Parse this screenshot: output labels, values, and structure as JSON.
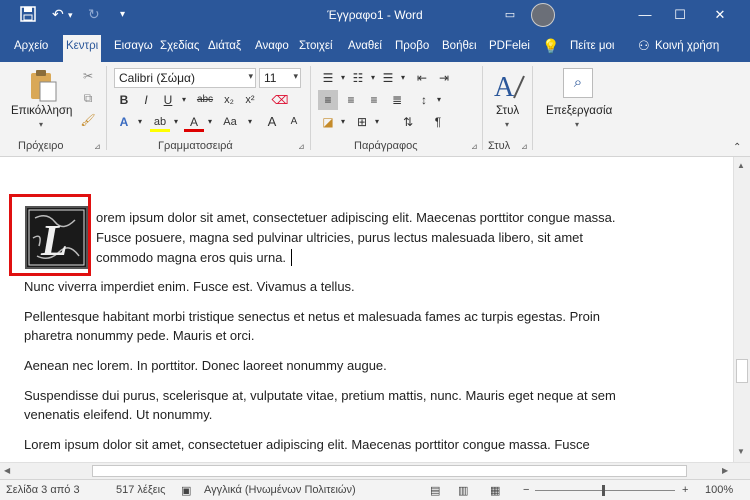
{
  "titlebar": {
    "title": "Έγγραφο1 - Word",
    "save_icon": "save-icon",
    "undo_icon": "undo-icon",
    "redo_icon": "redo-icon",
    "customize_icon": "chevron-down-icon"
  },
  "tabs": [
    {
      "label": "Αρχείο"
    },
    {
      "label": "Κεντρι"
    },
    {
      "label": "Εισαγω"
    },
    {
      "label": "Σχεδίας"
    },
    {
      "label": "Διάταξ"
    },
    {
      "label": "Αναφο"
    },
    {
      "label": "Στοιχεί"
    },
    {
      "label": "Αναθεί"
    },
    {
      "label": "Προβο"
    },
    {
      "label": "Βοήθει"
    },
    {
      "label": "PDFelei"
    },
    {
      "label": "Πείτε μοι"
    },
    {
      "label": "Κοινή χρήση"
    }
  ],
  "ribbon": {
    "paste_label": "Επικόλληση",
    "font_name": "Calibri (Σώμα)",
    "font_size": "11",
    "styles_label": "Στυλ",
    "editing_label": "Επεξεργασία",
    "groups": {
      "clipboard": "Πρόχειρο",
      "font": "Γραμματοσειρά",
      "paragraph": "Παράγραφος",
      "styles": "Στυλ"
    },
    "buttons": {
      "bold": "B",
      "italic": "I",
      "underline": "U",
      "strike": "abc",
      "sub": "x₂",
      "sup": "x²",
      "font_color": "A",
      "highlight": "ab",
      "case": "Aa",
      "grow": "A",
      "shrink": "A"
    }
  },
  "document": {
    "paragraphs": [
      "orem ipsum dolor sit amet, consectetuer adipiscing elit. Maecenas porttitor congue massa.",
      "Fusce posuere, magna sed pulvinar ultricies, purus lectus malesuada libero, sit amet",
      "commodo magna eros quis urna.",
      "Nunc viverra imperdiet enim. Fusce est. Vivamus a tellus.",
      "Pellentesque habitant morbi tristique senectus et netus et malesuada fames ac turpis egestas. Proin",
      "pharetra nonummy pede. Mauris et orci.",
      "Aenean nec lorem. In porttitor. Donec laoreet nonummy augue.",
      "Suspendisse dui purus, scelerisque at, vulputate vitae, pretium mattis, nunc. Mauris eget neque at sem",
      "venenatis eleifend. Ut nonummy.",
      "Lorem ipsum dolor sit amet, consectetuer adipiscing elit. Maecenas porttitor congue massa. Fusce"
    ]
  },
  "status": {
    "page": "Σελίδα 3 από 3",
    "words": "517 λέξεις",
    "language": "Αγγλικά (Ηνωμένων Πολιτειών)",
    "zoom": "100%"
  },
  "colors": {
    "brand": "#2b579a",
    "highlight_border": "#e01010"
  }
}
